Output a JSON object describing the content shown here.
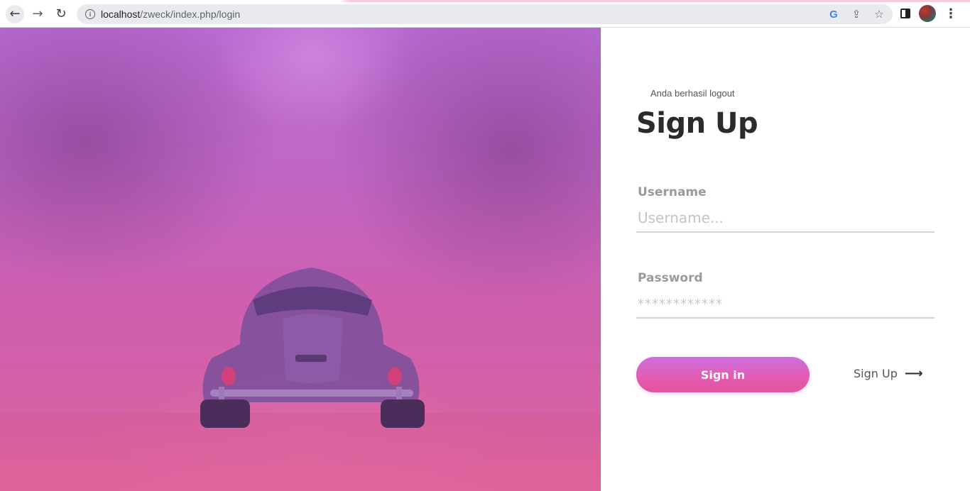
{
  "browser": {
    "url_host": "localhost",
    "url_path": "/zweck/index.php/login",
    "back_icon": "←",
    "forward_icon": "→",
    "reload_icon": "↻",
    "info_icon": "i",
    "google_icon": "G",
    "share_icon": "⇪",
    "star_icon": "☆",
    "kebab_icon": "⋮"
  },
  "form": {
    "flash_message": "Anda berhasil logout",
    "title": "Sign Up",
    "username_label": "Username",
    "username_placeholder": "Username...",
    "password_label": "Password",
    "password_placeholder": "************",
    "signin_label": "Sign in",
    "signup_label": "Sign Up",
    "signup_arrow": "⟶"
  },
  "colors": {
    "button_top": "#cc6fe0",
    "button_bottom": "#e2549f",
    "hero_overlay_top": "#b86ad0",
    "hero_overlay_bottom": "#d9629f"
  }
}
